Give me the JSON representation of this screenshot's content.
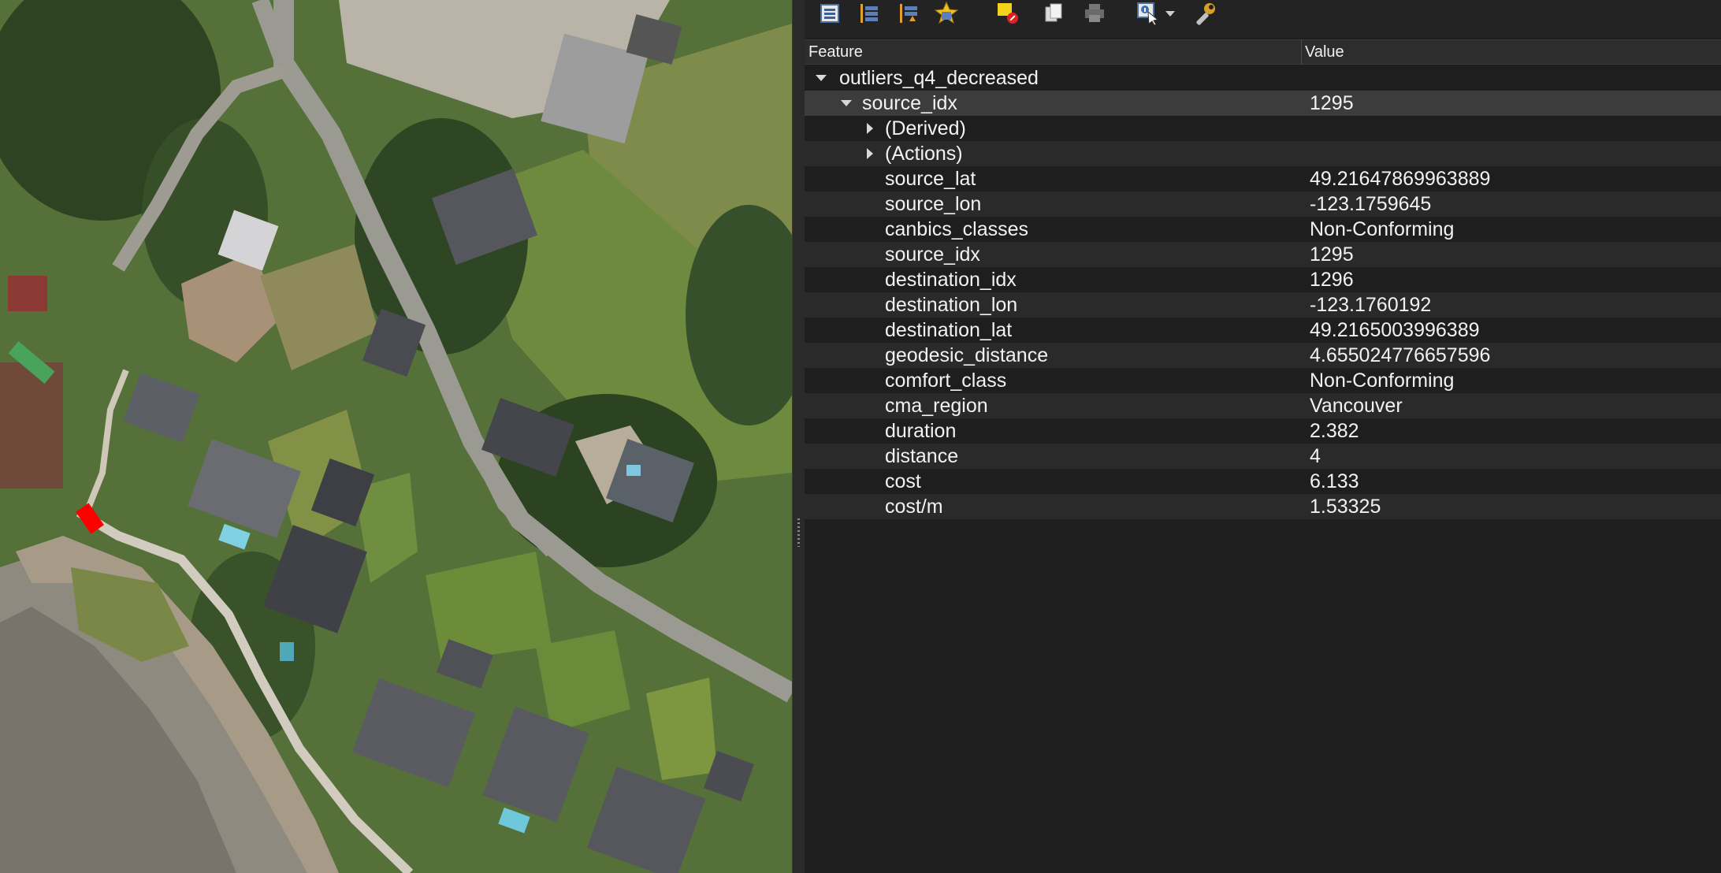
{
  "toolbar": {
    "buttons": [
      {
        "icon": "expand-tree-icon"
      },
      {
        "icon": "collapse-tree-icon"
      },
      {
        "icon": "expand-new-results-icon"
      },
      {
        "icon": "highlight-features-icon"
      },
      {
        "icon": "clear-results-icon"
      },
      {
        "icon": "copy-feature-icon"
      },
      {
        "icon": "print-icon"
      },
      {
        "icon": "identify-mode-icon"
      },
      {
        "icon": "dropdown-arrow-icon"
      },
      {
        "icon": "settings-wrench-icon"
      }
    ]
  },
  "table": {
    "col_feature": "Feature",
    "col_value": "Value"
  },
  "tree": {
    "layer": "outliers_q4_decreased",
    "feature": {
      "key": "source_idx",
      "value": "1295"
    },
    "groups": [
      "(Derived)",
      "(Actions)"
    ],
    "attributes": [
      {
        "key": "source_lat",
        "value": "49.21647869963889"
      },
      {
        "key": "source_lon",
        "value": "-123.1759645"
      },
      {
        "key": "canbics_classes",
        "value": "Non-Conforming"
      },
      {
        "key": "source_idx",
        "value": "1295"
      },
      {
        "key": "destination_idx",
        "value": "1296"
      },
      {
        "key": "destination_lon",
        "value": "-123.1760192"
      },
      {
        "key": "destination_lat",
        "value": "49.2165003996389"
      },
      {
        "key": "geodesic_distance",
        "value": "4.655024776657596"
      },
      {
        "key": "comfort_class",
        "value": "Non-Conforming"
      },
      {
        "key": "cma_region",
        "value": "Vancouver"
      },
      {
        "key": "duration",
        "value": "2.382"
      },
      {
        "key": "distance",
        "value": "4"
      },
      {
        "key": "cost",
        "value": "6.133"
      },
      {
        "key": "cost/m",
        "value": "1.53325"
      }
    ]
  },
  "colors": {
    "highlight": "#ff0000",
    "panel_bg": "#1e1e1e",
    "row_alt": "#2a2a2a",
    "row_selected": "#3c3c3c"
  }
}
